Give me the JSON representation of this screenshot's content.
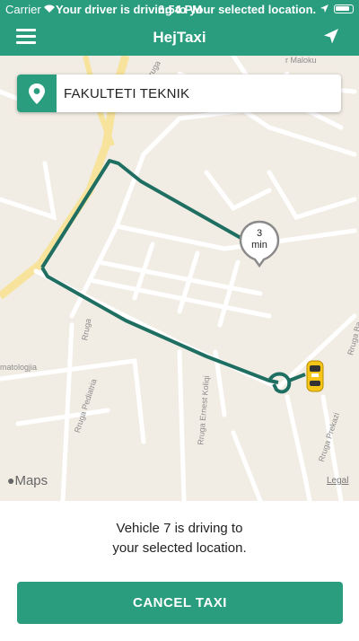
{
  "status_bar": {
    "carrier": "Carrier",
    "banner": "Your driver is driving to your selected location.",
    "time": "6:54 PM"
  },
  "nav": {
    "title": "HejTaxi",
    "menu_icon": "hamburger-menu-icon",
    "navigation_icon": "navigation-arrow-icon"
  },
  "map": {
    "destination": "FAKULTETI TEKNIK",
    "eta_value": "3",
    "eta_unit": "min",
    "attribution": "Maps",
    "legal": "Legal",
    "street_labels": [
      "Rruga",
      "Rruga Pediatria",
      "Rruga Ernest Koliqi",
      "Rruga Prekazi",
      "Rruga Ba",
      "r Maloku",
      "matologjia",
      "Rruga"
    ]
  },
  "ride": {
    "status_text_line1": "Vehicle 7 is driving to",
    "status_text_line2": "your selected location.",
    "cancel_label": "CANCEL TAXI"
  },
  "colors": {
    "brand": "#2a9d7f",
    "route": "#1f6e62",
    "map_bg": "#f2ede4",
    "taxi": "#f5c518"
  }
}
